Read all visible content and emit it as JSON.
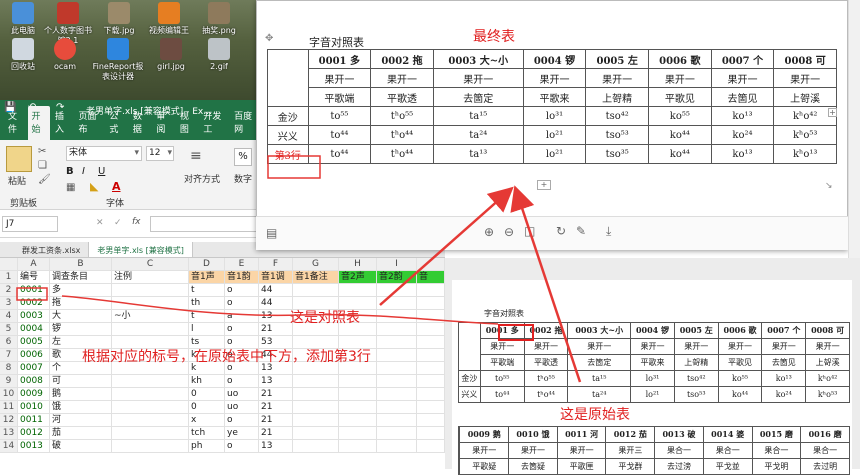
{
  "desktop": {
    "icons": [
      {
        "label": "此电脑",
        "icon": "computer-icon"
      },
      {
        "label": "个人数字图书馆2.1",
        "icon": "library-icon"
      },
      {
        "label": "下载.jpg",
        "icon": "image-file-icon"
      },
      {
        "label": "视频编辑王",
        "icon": "video-editor-icon"
      },
      {
        "label": "抽奖.png",
        "icon": "image-file-icon"
      },
      {
        "label": "回收站",
        "icon": "recycle-bin-icon"
      },
      {
        "label": "ocam",
        "icon": "ocam-icon"
      },
      {
        "label": "FineReport报表设计器",
        "icon": "finereport-icon"
      },
      {
        "label": "girl.jpg",
        "icon": "image-file-icon"
      },
      {
        "label": "2.gif",
        "icon": "gif-file-icon"
      }
    ]
  },
  "excel": {
    "title": "老男单字.xls [兼容模式] - Ex...",
    "tabs": [
      "文件",
      "开始",
      "插入",
      "页面布",
      "公式",
      "数据",
      "审阅",
      "视图",
      "开发工",
      "百度网"
    ],
    "active_tab": "开始",
    "font_name": "宋体",
    "font_size": "12",
    "groups": {
      "clipboard": "剪贴板",
      "font": "字体"
    },
    "paste_label": "粘贴",
    "align_label": "对齐方式",
    "number_label": "数字",
    "percent": "%",
    "name_box": "J7",
    "fx": "fx",
    "sheet_tabs": [
      "群发工资条.xlsx",
      "老男单字.xls [兼容模式]"
    ],
    "column_headers": [
      "A",
      "B",
      "C",
      "D",
      "E",
      "F",
      "G",
      "H",
      "I"
    ],
    "header_row": [
      "编号",
      "调查条目",
      "注例",
      "音1声",
      "音1韵",
      "音1调",
      "音1备注",
      "音2声",
      "音2韵",
      "音"
    ],
    "rows": [
      [
        "0001",
        "多",
        "",
        "t",
        "o",
        "44",
        "",
        "",
        ""
      ],
      [
        "0002",
        "拖",
        "",
        "th",
        "o",
        "44",
        "",
        "",
        ""
      ],
      [
        "0003",
        "大",
        "~小",
        "t",
        "a",
        "13",
        "",
        "",
        ""
      ],
      [
        "0004",
        "锣",
        "",
        "l",
        "o",
        "21",
        "",
        "",
        ""
      ],
      [
        "0005",
        "左",
        "",
        "ts",
        "o",
        "53",
        "",
        "",
        ""
      ],
      [
        "0006",
        "歌",
        "",
        "k",
        "o",
        "44",
        "",
        "",
        ""
      ],
      [
        "0007",
        "个",
        "",
        "k",
        "o",
        "13",
        "",
        "",
        ""
      ],
      [
        "0008",
        "可",
        "",
        "kh",
        "o",
        "13",
        "",
        "",
        ""
      ],
      [
        "0009",
        "鹅",
        "",
        "0",
        "uo",
        "21",
        "",
        "",
        ""
      ],
      [
        "0010",
        "饿",
        "",
        "0",
        "uo",
        "21",
        "",
        "",
        ""
      ],
      [
        "0011",
        "河",
        "",
        "x",
        "o",
        "21",
        "",
        "",
        ""
      ],
      [
        "0012",
        "茄",
        "",
        "tch",
        "ye",
        "21",
        "",
        "",
        ""
      ],
      [
        "0013",
        "破",
        "",
        "ph",
        "o",
        "13",
        "",
        "",
        ""
      ]
    ],
    "row_numbers": [
      "1",
      "2",
      "3",
      "4",
      "5",
      "6",
      "7",
      "8",
      "9",
      "10",
      "11",
      "12",
      "13",
      "14"
    ]
  },
  "popup": {
    "table_title": "字音对照表",
    "label": "最终表",
    "headers": [
      "0001 多",
      "0002 拖",
      "0003 大~小",
      "0004 锣",
      "0005 左",
      "0006 歌",
      "0007 个",
      "0008 可"
    ],
    "row_a": [
      "果开一",
      "果开一",
      "果开一",
      "果开一",
      "果开一",
      "果开一",
      "果开一",
      "果开一"
    ],
    "row_b": [
      "平歌端",
      "平歌透",
      "去箇定",
      "平歌来",
      "上哿精",
      "平歌见",
      "去箇见",
      "上哿溪"
    ],
    "places": [
      "金沙",
      "兴义",
      "第3行"
    ],
    "jinsha": [
      "to⁵⁵",
      "tʰo⁵⁵",
      "ta¹⁵",
      "lo³¹",
      "tso⁴²",
      "ko⁵⁵",
      "ko¹³",
      "kʰo⁴²"
    ],
    "xingyi": [
      "to⁴⁴",
      "tʰo⁴⁴",
      "ta²⁴",
      "lo²¹",
      "tso⁵³",
      "ko⁴⁴",
      "ko²⁴",
      "kʰo⁵³"
    ],
    "row3": [
      "to⁴⁴",
      "tʰo⁴⁴",
      "ta¹³",
      "lo²¹",
      "tso³⁵",
      "ko⁴⁴",
      "ko¹³",
      "kʰo¹³"
    ]
  },
  "annotations": {
    "compare": "这是对照表",
    "original": "这是原始表",
    "instruction": "根据对应的标号，在原始表中下方，添加第3行"
  },
  "original": {
    "table_title": "字音对照表",
    "headers": [
      "0001 多",
      "0002 拖",
      "0003 大~小",
      "0004 锣",
      "0005 左",
      "0006 歌",
      "0007 个",
      "0008 可"
    ],
    "row_a": [
      "果开一",
      "果开一",
      "果开一",
      "果开一",
      "果开一",
      "果开一",
      "果开一",
      "果开一"
    ],
    "row_b": [
      "平歌端",
      "平歌透",
      "去箇定",
      "平歌来",
      "上哿精",
      "平歌见",
      "去箇见",
      "上哿溪"
    ],
    "places": [
      "金沙",
      "兴义"
    ],
    "jinsha": [
      "to⁵⁵",
      "tʰo⁵⁵",
      "ta¹⁵",
      "lo³¹",
      "tso⁴²",
      "ko⁵⁵",
      "ko¹³",
      "kʰo⁴²"
    ],
    "xingyi": [
      "to⁴⁴",
      "tʰo⁴⁴",
      "ta²⁴",
      "lo²¹",
      "tso⁵³",
      "ko⁴⁴",
      "ko²⁴",
      "kʰo⁵³"
    ],
    "headers2": [
      "0009 鹅",
      "0010 饿",
      "0011 河",
      "0012 茄",
      "0013 破",
      "0014 婆",
      "0015 磨",
      "0016 磨"
    ],
    "row_a2": [
      "果开一",
      "果开一",
      "果开一",
      "果开三",
      "果合一",
      "果合一",
      "果合一",
      "果合一"
    ],
    "row_b2": [
      "平歌疑",
      "去箇疑",
      "平歌匣",
      "平戈群",
      "去过滂",
      "平戈並",
      "平戈明",
      "去过明"
    ]
  }
}
